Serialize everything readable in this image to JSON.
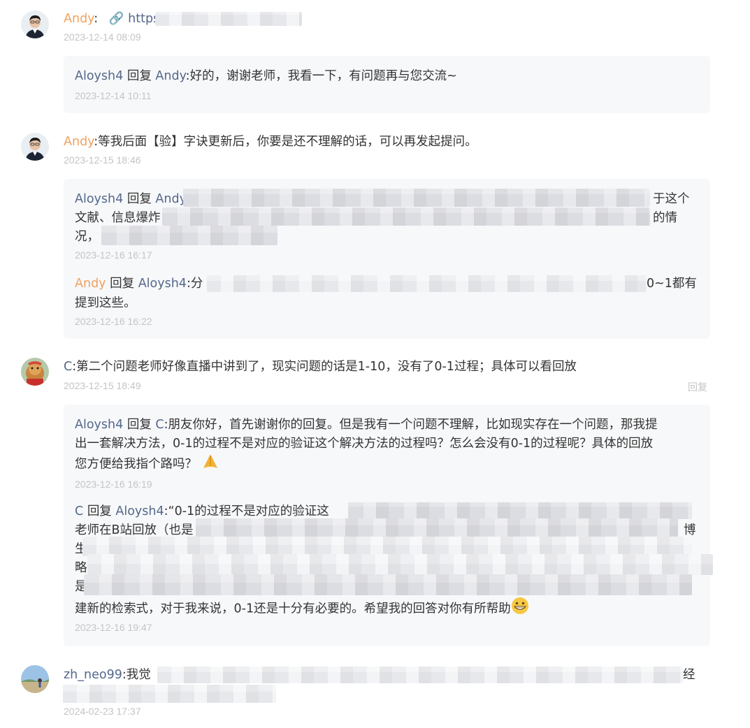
{
  "comments": [
    {
      "user": "Andy",
      "sep": ":",
      "link_icon": "link-icon",
      "text": "https",
      "time": "2023-12-14 08:09",
      "replies": [
        {
          "from": "Aloysh4",
          "verb": "回复",
          "to": "Andy",
          "sep": ":",
          "text": "好的，谢谢老师，我看一下，有问题再与您交流~",
          "time": "2023-12-14 10:11"
        }
      ]
    },
    {
      "user": "Andy",
      "sep": ":",
      "text": "等我后面【验】字诀更新后，你要是还不理解的话，可以再发起提问。",
      "time": "2023-12-15 18:46",
      "replies": [
        {
          "from": "Aloysh4",
          "verb": "回复",
          "to": "Andy",
          "text_end1": "于这个",
          "text_line2_start": "文献、信息爆炸",
          "text_line2_end": "的情",
          "text_line3_start": "况，",
          "time": "2023-12-16 16:17"
        },
        {
          "from": "Andy",
          "verb": "回复",
          "to": "Aloysh4",
          "sep": ":",
          "text_start": "分",
          "text_end1": "0~1都有",
          "text_line2": "提到这些。",
          "time": "2023-12-16 16:22"
        }
      ]
    },
    {
      "user": "C",
      "sep": ":",
      "text": "第二个问题老师好像直播中讲到了，现实问题的话是1-10，没有了0-1过程；具体可以看回放",
      "time": "2023-12-15 18:49",
      "reply_label": "回复",
      "replies": [
        {
          "from": "Aloysh4",
          "verb": "回复",
          "to": "C",
          "sep": ":",
          "line1": "朋友你好，首先谢谢你的回复。但是我有一个问题不理解，比如现实存在一个问题，那我提",
          "line2": "出一套解决方法，0-1的过程不是对应的验证这个解决方法的过程吗？怎么会没有0-1的过程呢？具体的回放",
          "line3": "您方便给我指个路吗？",
          "time": "2023-12-16 16:19"
        },
        {
          "from": "C",
          "verb": "回复",
          "to": "Aloysh4",
          "sep": ":",
          "line1_start": "“0-1的过程不是对应的验证这",
          "line2_start": "老师在B站回放（也是",
          "line2_end": "博",
          "line3_start": "生",
          "line4_start": "略",
          "line5_start": "是",
          "line6": "建新的检索式，对于我来说，0-1还是十分有必要的。希望我的回答对你有所帮助",
          "time": "2023-12-16 19:47"
        }
      ]
    },
    {
      "user": "zh_neo99",
      "sep": ":",
      "text_start": "我觉",
      "text_end": "经",
      "time": "2024-02-23 17:37"
    }
  ]
}
